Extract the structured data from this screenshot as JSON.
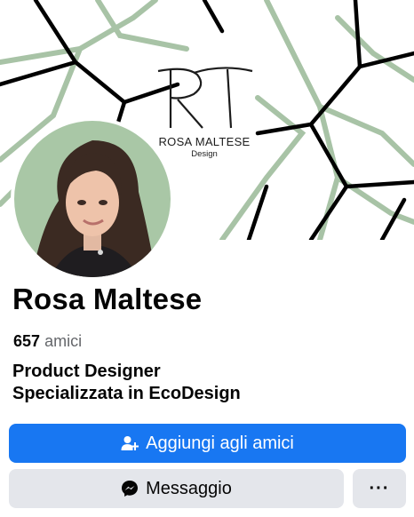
{
  "cover": {
    "logo_monogram": "RT",
    "logo_name": "ROSA MALTESE",
    "logo_sub": "Design",
    "pattern_colors": [
      "#000000",
      "#a8c3a6"
    ]
  },
  "profile": {
    "name": "Rosa Maltese",
    "friends_count": "657",
    "friends_label": "amici",
    "bio_line1": "Product Designer",
    "bio_line2": "Specializzata in EcoDesign"
  },
  "actions": {
    "add_friend_label": "Aggiungi agli amici",
    "add_friend_icon": "add-friend-icon",
    "message_label": "Messaggio",
    "message_icon": "messenger-icon",
    "more_label": "···",
    "colors": {
      "primary": "#1877f2",
      "secondary": "#e4e6eb"
    }
  }
}
